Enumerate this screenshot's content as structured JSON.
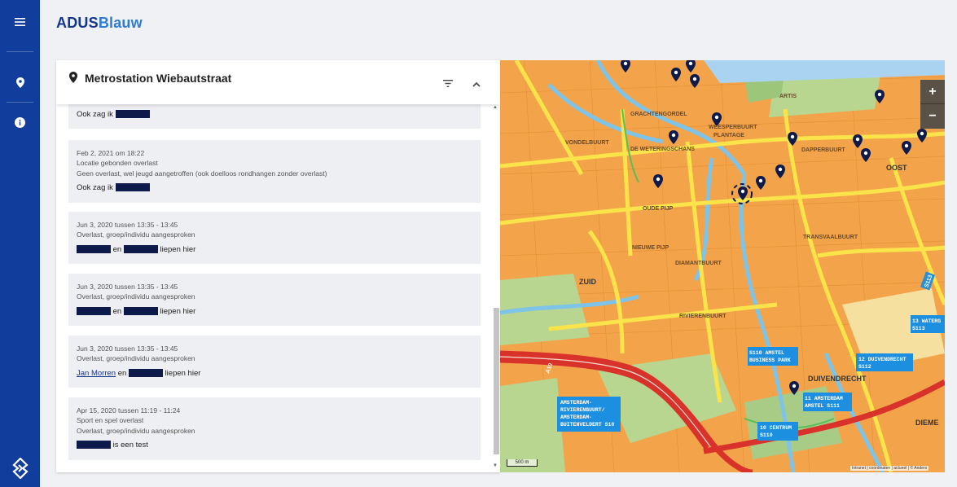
{
  "app": {
    "brand_a": "ADUS",
    "brand_b": "Blauw"
  },
  "rail": {
    "icons": [
      "menu-icon",
      "location-icon",
      "info-icon",
      "police-logo-icon"
    ]
  },
  "panel": {
    "title": "Metrostation Wiebautstraat",
    "cards": [
      {
        "meta": [],
        "body": "Ook zag ik"
      },
      {
        "meta": [
          "Feb 2, 2021 om 18:22",
          "Locatie gebonden overlast",
          "Geen overlast, wel jeugd aangetroffen (ook doelloos rondhangen zonder overlast)"
        ],
        "body": "Ook zag ik"
      },
      {
        "meta": [
          "Jun 3, 2020 tussen 13:35 - 13:45",
          "Overlast, groep/individu aangesproken"
        ],
        "body_mid": "en",
        "body_end": "liepen hier"
      },
      {
        "meta": [
          "Jun 3, 2020 tussen 13:35 - 13:45",
          "Overlast, groep/individu aangesproken"
        ],
        "body_mid": "en",
        "body_end": "liepen hier"
      },
      {
        "meta": [
          "Jun 3, 2020 tussen 13:35 - 13:45",
          "Overlast, groep/individu aangesproken"
        ],
        "body_link": "Jan Morren",
        "body_mid": "en",
        "body_end": "liepen hier"
      },
      {
        "meta": [
          "Apr 15, 2020 tussen 11:19 - 11:24",
          "Sport en spel overlast",
          "Overlast, groep/individu aangesproken"
        ],
        "body_end": "is een test"
      }
    ]
  },
  "map": {
    "zoom_in": "+",
    "zoom_out": "−",
    "scale": "500 m",
    "attribution": "Intranet | coordinaten | actueel | © Anders",
    "labels": {
      "artis": "ARTIS",
      "grachtengordel": "GRACHTENGORDEL",
      "zuid": "ZUID",
      "weesperbuurt": "WEESPERBUURT",
      "plantage": "PLANTAGE",
      "dapperbuurt": "DAPPERBUURT",
      "oost": "OOST",
      "oude_pijp": "OUDE PIJP",
      "nieuwe_pijp": "NIEUWE PIJP",
      "diamantbuurt": "DIAMANTBUURT",
      "rivierenbuurt": "RIVIERENBUURT",
      "transvaalbuurt": "TRANSVAALBUURT",
      "duivendrecht": "DUIVENDRECHT",
      "weteringschans": "DE WETERINGSCHANS",
      "vondelbuurt": "VONDELBUURT",
      "diemen": "DIEME",
      "a10": "A10",
      "s110_centrum": "10 CENTRUM",
      "s110_centrum_b": "S110",
      "s110_amstel": "S110 AMSTEL",
      "business_park": "BUSINESS PARK",
      "s111_a": "11 AMSTERDAM",
      "s111_b": "AMSTEL S111",
      "s112_a": "12 DUIVENDRECHT",
      "s112_b": "S112",
      "s113_a": "13 WATERG",
      "s113_b": "S113",
      "s10_a": "AMSTERDAM-",
      "s10_b": "RIVIERENBUURT/",
      "s10_c": "AMSTERDAM-",
      "s10_d": "BUITENVELDERT S10",
      "s113_road": "S113"
    }
  }
}
